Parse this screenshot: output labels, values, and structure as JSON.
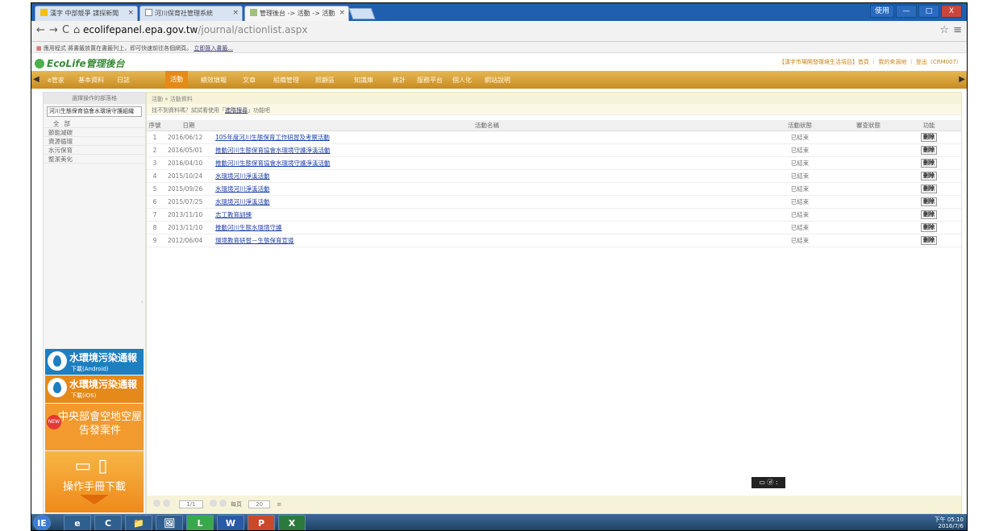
{
  "browser": {
    "tabs": [
      {
        "label": "漢字 中部競爭 諜探新聞"
      },
      {
        "label": "河川保育社管理系統"
      },
      {
        "label": "管理後台 -> 活動 -> 活動"
      }
    ],
    "window_controls": {
      "user": "使用",
      "minimize": "—",
      "maximize": "□",
      "close": "X"
    },
    "url_host": "ecolifepanel.epa.gov.tw",
    "url_path": "/journal/actionlist.aspx",
    "bookmarks_text": "應用程式   將書籤放置在書籤列上，即可快速前往各個網頁。",
    "bookmarks_link": "立即匯入書籤..."
  },
  "site": {
    "logo": "EcoLife管理後台",
    "toplinks": "【漢字市場開發環境生活項目】首頁 ｜ 我的來源地 ｜ 登出（CRM007）",
    "menu": [
      "e管家",
      "基本資料",
      "日誌",
      "活動",
      "績效填報",
      "文章",
      "組織管理",
      "照顧區",
      "知識庫",
      "統計",
      "服務平台",
      "個人化",
      "網站說明"
    ],
    "menu_selected_index": 3
  },
  "sidebar": {
    "title": "選擇操作的部落格",
    "select_value": "河川生態保育協會水環境守護組織",
    "items": [
      "全部",
      "節能減碳",
      "資源循環",
      "水污保育",
      "整潔美化"
    ],
    "promo1_title": "水環境污染通報",
    "promo1_sub": "下載(Android)",
    "promo2_title": "水環境污染通報",
    "promo2_sub": "下載(iOS)",
    "promo3_badge": "NEW",
    "promo3_text": "中央部會空地空屋告發案件",
    "promo4_text": "操作手冊下載"
  },
  "main": {
    "breadcrumb": "活動 » 活動資料",
    "notice_prefix": "找不到資料嗎？試試看使用「",
    "notice_link": "進階搜尋",
    "notice_suffix": "」功能吧",
    "columns": {
      "no": "序號",
      "date": "日期",
      "name": "活動名稱",
      "status": "活動狀態",
      "review": "審查狀態",
      "action": "功能"
    },
    "rows": [
      {
        "no": "1",
        "date": "2016/06/12",
        "name": "105年度河川生態保育工作研習及考察活動",
        "status": "已結束",
        "action": "刪除"
      },
      {
        "no": "2",
        "date": "2016/05/01",
        "name": "推動河川生態保育協會水環境守護淨溪活動",
        "status": "已結束",
        "action": "刪除"
      },
      {
        "no": "3",
        "date": "2016/04/10",
        "name": "推動河川生態保育協會水環境守護淨溪活動",
        "status": "已結束",
        "action": "刪除"
      },
      {
        "no": "4",
        "date": "2015/10/24",
        "name": "水環境河川淨溪活動",
        "status": "已結束",
        "action": "刪除"
      },
      {
        "no": "5",
        "date": "2015/09/26",
        "name": "水環境河川淨溪活動",
        "status": "已結束",
        "action": "刪除"
      },
      {
        "no": "6",
        "date": "2015/07/25",
        "name": "水環境河川淨溪活動",
        "status": "已結束",
        "action": "刪除"
      },
      {
        "no": "7",
        "date": "2013/11/10",
        "name": "志工教育訓練",
        "status": "已結束",
        "action": "刪除"
      },
      {
        "no": "8",
        "date": "2013/11/10",
        "name": "推動河川生態水環境守護",
        "status": "已結束",
        "action": "刪除"
      },
      {
        "no": "9",
        "date": "2012/06/04",
        "name": "環境教育研習－生態保育宣導",
        "status": "已結束",
        "action": "刪除"
      }
    ],
    "pager": {
      "page": "1/1",
      "per_page_label": "每頁",
      "per_page": "20"
    },
    "ime": "▭ ⓓ :"
  },
  "taskbar": {
    "apps": [
      "IE",
      "e",
      "C",
      "📁",
      "🖼",
      "L",
      "W",
      "P",
      "X"
    ],
    "time": "下午 05:10",
    "date": "2016/7/6"
  }
}
